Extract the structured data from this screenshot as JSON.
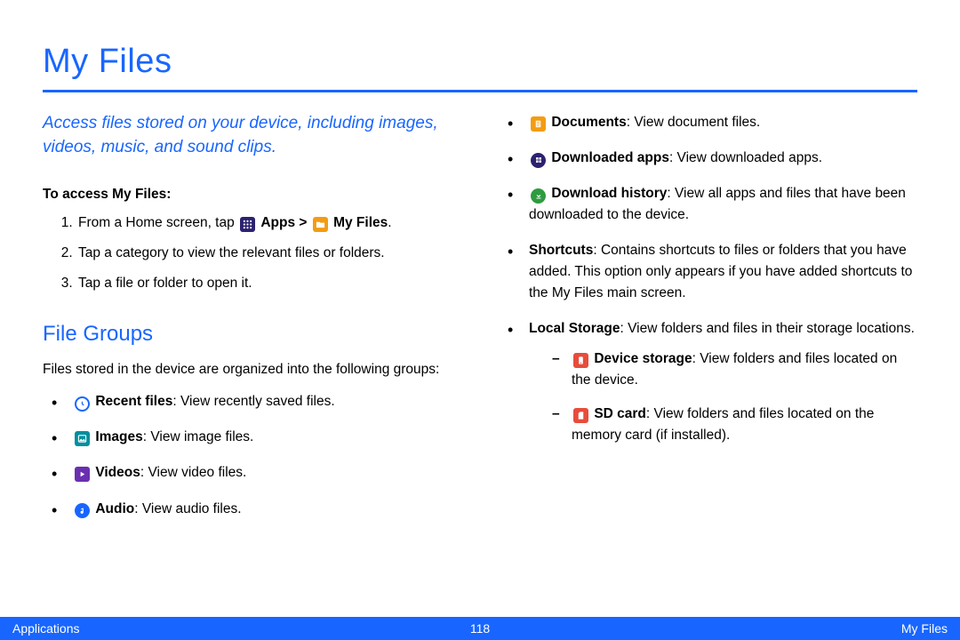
{
  "title": "My Files",
  "intro": "Access files stored on your device, including images, videos, music, and sound clips.",
  "access_heading": "To access My Files:",
  "steps": {
    "s1a": "From a Home screen, tap ",
    "s1_apps": " Apps",
    "s1_gt": " > ",
    "s1_myfiles": " My Files",
    "s1b": ".",
    "s2": "Tap a category to view the relevant files or folders.",
    "s3": "Tap a file or folder to open it."
  },
  "file_groups_h": "File Groups",
  "file_groups_p": "Files stored in the device are organized into the following groups:",
  "left": {
    "recent_b": "Recent files",
    "recent_t": ": View recently saved files.",
    "images_b": "Images",
    "images_t": ": View image files.",
    "videos_b": "Videos",
    "videos_t": ": View video files.",
    "audio_b": "Audio",
    "audio_t": ": View audio files."
  },
  "right": {
    "docs_b": "Documents",
    "docs_t": ": View document files.",
    "dapps_b": "Downloaded apps",
    "dapps_t": ": View downloaded apps.",
    "dhist_b": "Download history",
    "dhist_t": ": View all apps and files that have been downloaded to the device.",
    "short_b": "Shortcuts",
    "short_t": ": Contains shortcuts to files or folders that you have added. This option only appears if you have added shortcuts to the My Files main screen.",
    "local_b": "Local Storage",
    "local_t": ": View folders and files in their storage locations.",
    "dev_b": "Device storage",
    "dev_t": ": View folders and files located on the device.",
    "sd_b": "SD card",
    "sd_t": ": View folders and files located on the memory card (if installed)."
  },
  "footer": {
    "left": "Applications",
    "center": "118",
    "right": "My Files"
  },
  "colors": {
    "blue": "#1866ff",
    "indigo": "#2b2270",
    "purple": "#6a2fb0",
    "teal": "#008f9e",
    "green": "#2e9b3f",
    "orange": "#f39c12",
    "red": "#e74c3c",
    "brown": "#8d5b2e"
  }
}
